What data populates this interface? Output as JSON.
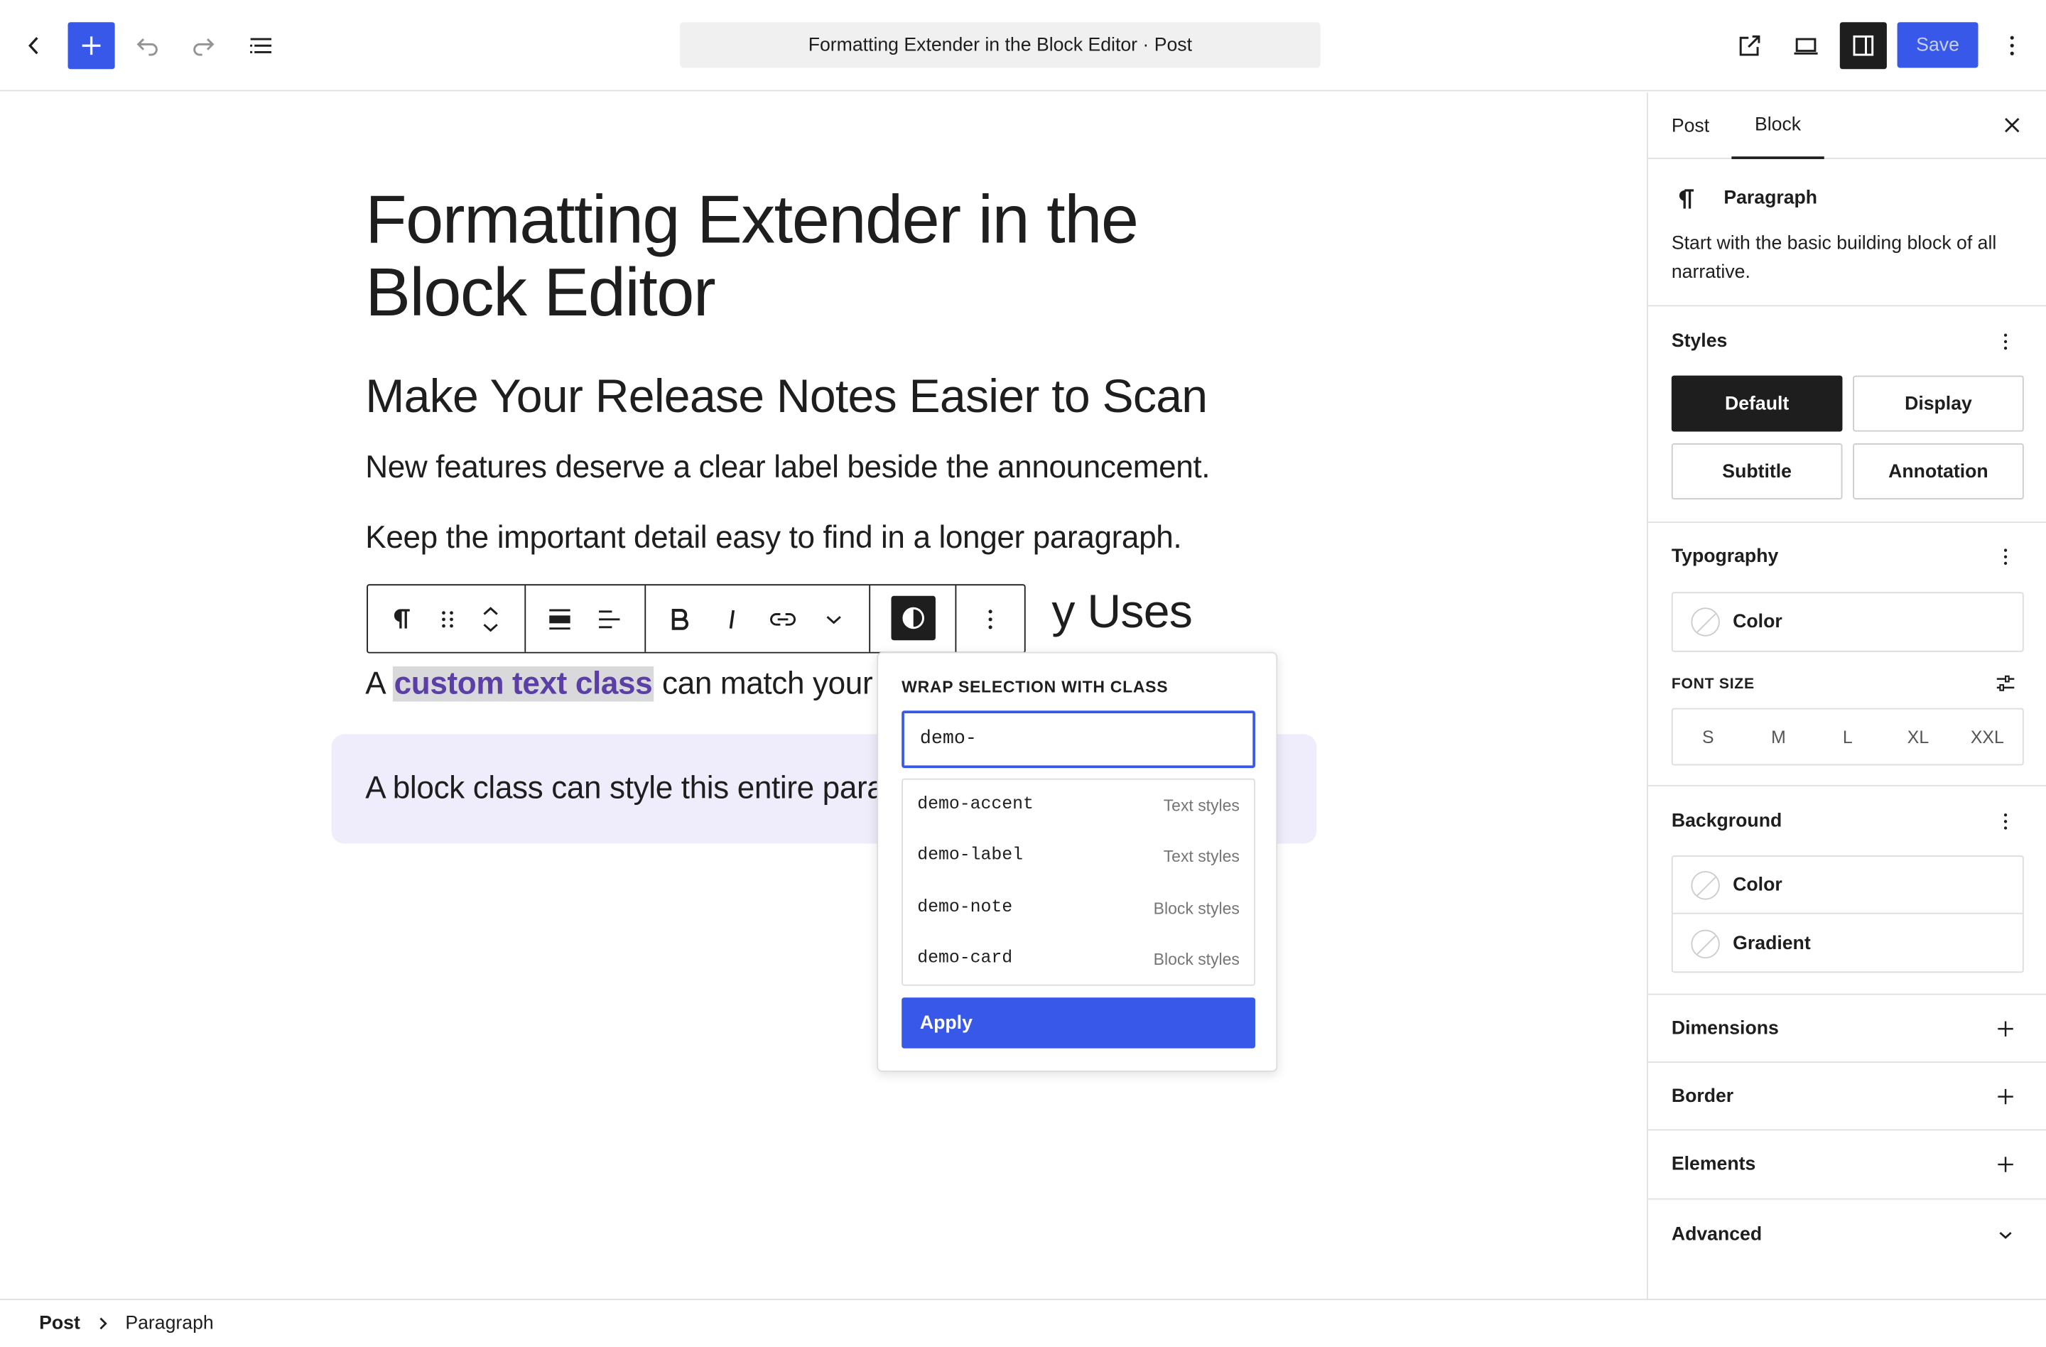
{
  "topbar": {
    "document_title": "Formatting Extender in the Block Editor · Post",
    "save_label": "Save"
  },
  "content": {
    "title": "Formatting Extender in the Block Editor",
    "heading1": "Make Your Release Notes Easier to Scan",
    "para1": "New features deserve a clear label beside the announcement.",
    "para2": "Keep the important detail easy to find in a longer paragraph.",
    "heading2_visible": "y Uses",
    "para3_prefix": "A ",
    "para3_highlight": "custom text class",
    "para3_suffix": " can match your s",
    "note_text": "A block class can style this entire para"
  },
  "popover": {
    "title": "WRAP SELECTION WITH CLASS",
    "input_value": "demo-",
    "items": [
      {
        "name": "demo-accent",
        "category": "Text styles"
      },
      {
        "name": "demo-label",
        "category": "Text styles"
      },
      {
        "name": "demo-note",
        "category": "Block styles"
      },
      {
        "name": "demo-card",
        "category": "Block styles"
      }
    ],
    "apply_label": "Apply"
  },
  "sidebar": {
    "tabs": [
      "Post",
      "Block"
    ],
    "block_name": "Paragraph",
    "block_description": "Start with the basic building block of all narrative.",
    "styles": {
      "heading": "Styles",
      "options": [
        "Default",
        "Display",
        "Subtitle",
        "Annotation"
      ]
    },
    "typography": {
      "heading": "Typography",
      "color_label": "Color",
      "font_size_label": "FONT SIZE",
      "sizes": [
        "S",
        "M",
        "L",
        "XL",
        "XXL"
      ]
    },
    "background": {
      "heading": "Background",
      "color_label": "Color",
      "gradient_label": "Gradient"
    },
    "dimensions": "Dimensions",
    "border": "Border",
    "elements": "Elements",
    "advanced": "Advanced"
  },
  "footer": {
    "crumb_post": "Post",
    "crumb_paragraph": "Paragraph"
  },
  "colors": {
    "accent": "#3858e9",
    "highlight_text": "#5b3fa6",
    "note_background": "#efecfb"
  }
}
